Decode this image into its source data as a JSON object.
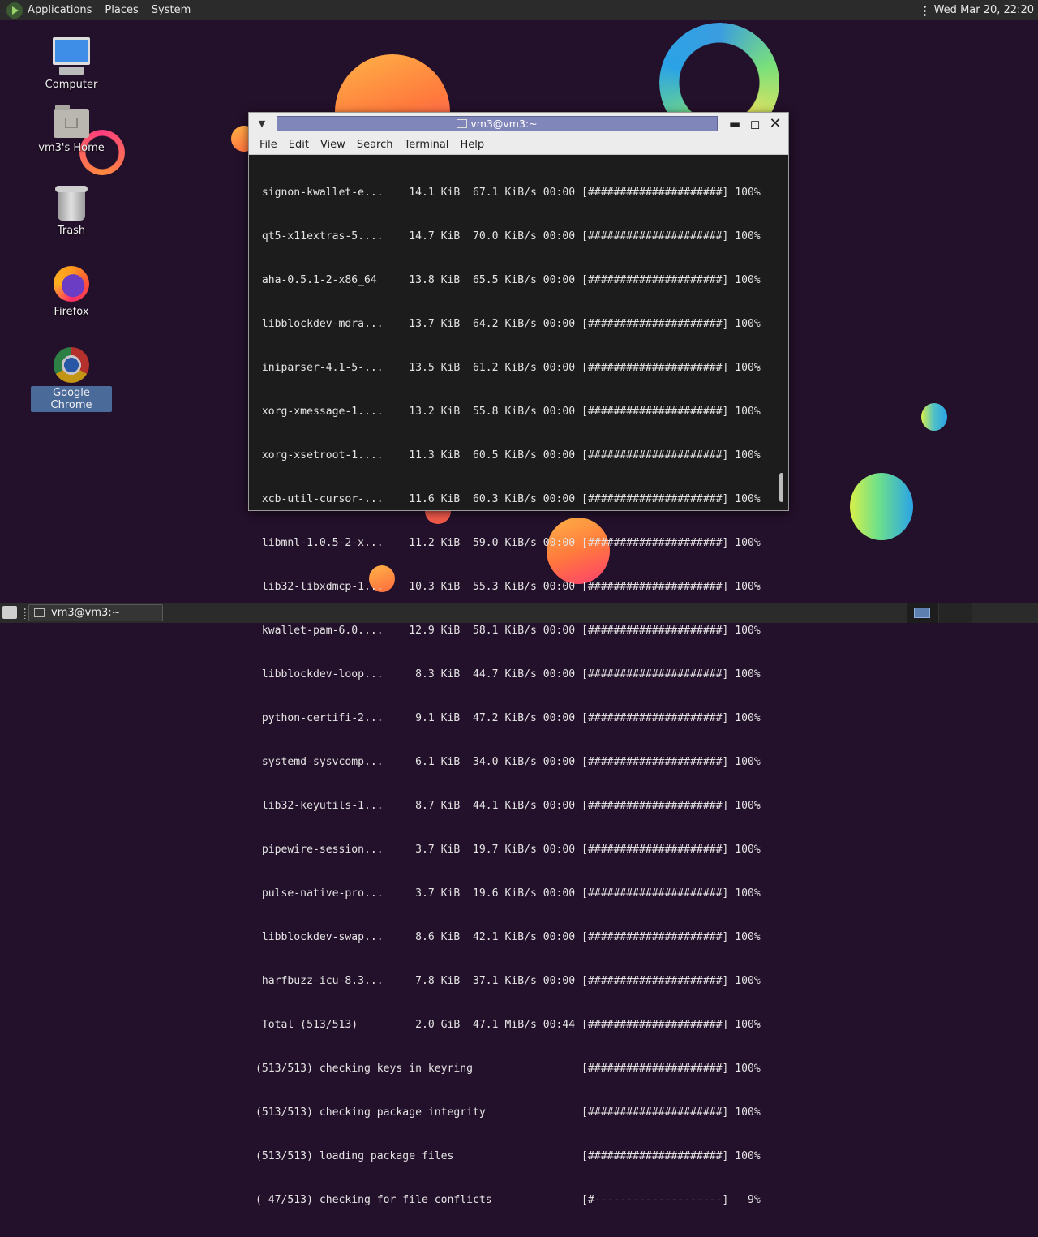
{
  "top_panel": {
    "menus": [
      "Applications",
      "Places",
      "System"
    ],
    "clock": "Wed Mar 20, 22:20"
  },
  "desktop_icons": [
    {
      "label": "Computer",
      "icon": "computer-icon"
    },
    {
      "label": "vm3's Home",
      "icon": "home-folder-icon"
    },
    {
      "label": "Trash",
      "icon": "trash-icon"
    },
    {
      "label": "Firefox",
      "icon": "firefox-icon"
    },
    {
      "label": "Google Chrome",
      "icon": "chrome-icon",
      "selected": true
    }
  ],
  "terminal": {
    "title": "vm3@vm3:~",
    "menus": [
      "File",
      "Edit",
      "View",
      "Search",
      "Terminal",
      "Help"
    ],
    "lines": [
      " signon-kwallet-e...    14.1 KiB  67.1 KiB/s 00:00 [#####################] 100%",
      " qt5-x11extras-5....    14.7 KiB  70.0 KiB/s 00:00 [#####################] 100%",
      " aha-0.5.1-2-x86_64     13.8 KiB  65.5 KiB/s 00:00 [#####################] 100%",
      " libblockdev-mdra...    13.7 KiB  64.2 KiB/s 00:00 [#####################] 100%",
      " iniparser-4.1-5-...    13.5 KiB  61.2 KiB/s 00:00 [#####################] 100%",
      " xorg-xmessage-1....    13.2 KiB  55.8 KiB/s 00:00 [#####################] 100%",
      " xorg-xsetroot-1....    11.3 KiB  60.5 KiB/s 00:00 [#####################] 100%",
      " xcb-util-cursor-...    11.6 KiB  60.3 KiB/s 00:00 [#####################] 100%",
      " libmnl-1.0.5-2-x...    11.2 KiB  59.0 KiB/s 00:00 [#####################] 100%",
      " lib32-libxdmcp-1...    10.3 KiB  55.3 KiB/s 00:00 [#####################] 100%",
      " kwallet-pam-6.0....    12.9 KiB  58.1 KiB/s 00:00 [#####################] 100%",
      " libblockdev-loop...     8.3 KiB  44.7 KiB/s 00:00 [#####################] 100%",
      " python-certifi-2...     9.1 KiB  47.2 KiB/s 00:00 [#####################] 100%",
      " systemd-sysvcomp...     6.1 KiB  34.0 KiB/s 00:00 [#####################] 100%",
      " lib32-keyutils-1...     8.7 KiB  44.1 KiB/s 00:00 [#####################] 100%",
      " pipewire-session...     3.7 KiB  19.7 KiB/s 00:00 [#####################] 100%",
      " pulse-native-pro...     3.7 KiB  19.6 KiB/s 00:00 [#####################] 100%",
      " libblockdev-swap...     8.6 KiB  42.1 KiB/s 00:00 [#####################] 100%",
      " harfbuzz-icu-8.3...     7.8 KiB  37.1 KiB/s 00:00 [#####################] 100%",
      " Total (513/513)         2.0 GiB  47.1 MiB/s 00:44 [#####################] 100%",
      "(513/513) checking keys in keyring                 [#####################] 100%",
      "(513/513) checking package integrity               [#####################] 100%",
      "(513/513) loading package files                    [#####################] 100%",
      "( 47/513) checking for file conflicts              [#--------------------]   9%"
    ]
  },
  "taskbar": {
    "task_label": "vm3@vm3:~"
  }
}
